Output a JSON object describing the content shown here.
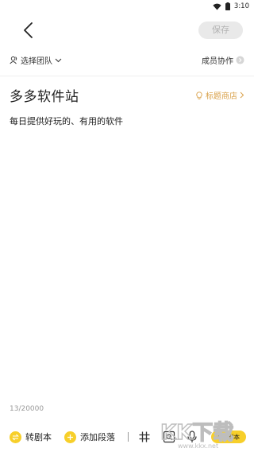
{
  "status": {
    "time": "3:10"
  },
  "header": {
    "save_label": "保存"
  },
  "toolbar": {
    "team_label": "选择团队",
    "collab_label": "成员协作"
  },
  "document": {
    "title": "多多软件站",
    "title_store_label": "标题商店",
    "body": "每日提供好玩的、有用的软件"
  },
  "counter": "13/20000",
  "bottom": {
    "to_script_label": "转剧本",
    "add_paragraph_label": "添加段落",
    "ai_script_ai": "AI",
    "ai_script_label": "剧本"
  },
  "watermark": {
    "text": "KK下载",
    "url": "www.kkx.net"
  },
  "colors": {
    "accent_yellow": "#f7cf2a",
    "store_gold": "#d9a14a",
    "disabled_grey": "#b3b3b3"
  }
}
